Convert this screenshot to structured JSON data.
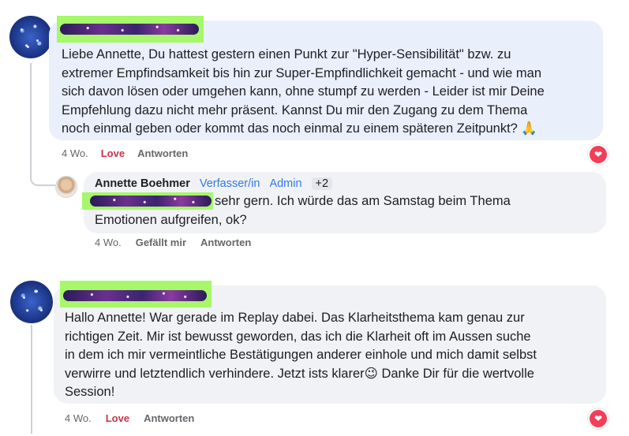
{
  "comments": [
    {
      "author_hidden": "",
      "text": "Liebe Annette, Du hattest gestern einen Punkt zur \"Hyper-Sensibilität\" bzw. zu\nextremer Empfindsamkeit bis hin zur Super-Empfindlichkeit gemacht - und wie man\nsich davon lösen oder umgehen kann, ohne stumpf zu werden - Leider ist mir Deine\nEmpfehlung dazu nicht mehr präsent. Kannst Du mir den Zugang zu dem Thema\nnoch einmal geben oder kommt das noch einmal zu einem späteren Zeitpunkt? 🙏",
      "time": "4 Wo.",
      "reaction": "Love",
      "reply_action": "Antworten"
    },
    {
      "author": "Annette Boehmer",
      "badges": [
        "Verfasser/in",
        "Admin"
      ],
      "extra_badges": "+2",
      "text_line1": "sehr gern. Ich würde das am Samstag beim Thema",
      "text_line2": "Emotionen aufgreifen, ok?",
      "time": "4 Wo.",
      "like_action": "Gefällt mir",
      "reply_action": "Antworten"
    },
    {
      "author_hidden": "",
      "text_pre": "Hallo Annette! War gerade im Replay dabei. Das Klarheitsthema kam genau zur\nrichtigen Zeit. Mir ist bewusst geworden, das ich die Klarheit oft im Aussen suche\nin dem ich mir vermeintliche Bestätigungen anderer einhole und mich damit selbst\nverwirre und letztendlich verhindere. Jetzt ists klarer",
      "emoji": "😉",
      "text_post": " Danke Dir für die wertvolle\nSession!",
      "time": "4 Wo.",
      "reaction": "Love",
      "reply_action": "Antworten"
    }
  ],
  "icons": {
    "reaction_heart": "heart-icon",
    "avatar_galaxy": "galaxy-avatar",
    "avatar_photo": "profile-photo"
  },
  "colors": {
    "highlight": "#a6f76a",
    "love": "#c9324a",
    "link_blue": "#3578e5",
    "bubble_blue": "#e9effb",
    "bubble_gray": "#f0f2f5"
  }
}
